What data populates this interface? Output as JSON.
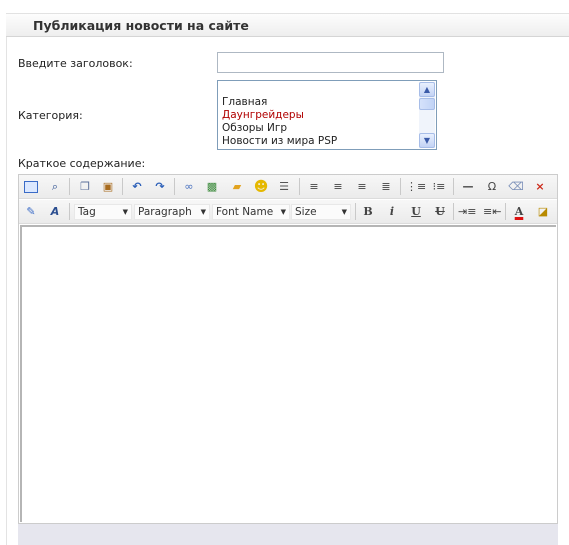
{
  "header": {
    "title": "Публикация новости на сайте"
  },
  "form": {
    "title_label": "Введите заголовок:",
    "title_value": "",
    "category_label": "Категория:",
    "categories": [
      "Главная",
      "Даунгрейдеры",
      "Обзоры Игр",
      "Новости из мира PSP"
    ],
    "selected_category": "Даунгрейдеры",
    "summary_label": "Краткое содержание:"
  },
  "editor": {
    "toolbar1": [
      "fullscreen-icon",
      "preview-icon",
      "copy-icon",
      "paste-icon",
      "undo-icon",
      "redo-icon",
      "link-icon",
      "image-icon",
      "folder-icon",
      "smiley-icon",
      "template-icon",
      "align-left-icon",
      "align-center-icon",
      "align-right-icon",
      "align-justify-icon",
      "ordered-list-icon",
      "unordered-list-icon",
      "horizontal-rule-icon",
      "special-char-icon",
      "eraser-icon",
      "delete-icon"
    ],
    "toolbar2": {
      "tag_label": "Tag",
      "paragraph_label": "Paragraph",
      "font_label": "Font Name",
      "size_label": "Size",
      "bold_label": "B",
      "italic_label": "i",
      "underline_label": "U",
      "strike_label": "U",
      "omega_label": "Ω",
      "text_color_label": "A",
      "delete_label": "×"
    },
    "content": ""
  }
}
